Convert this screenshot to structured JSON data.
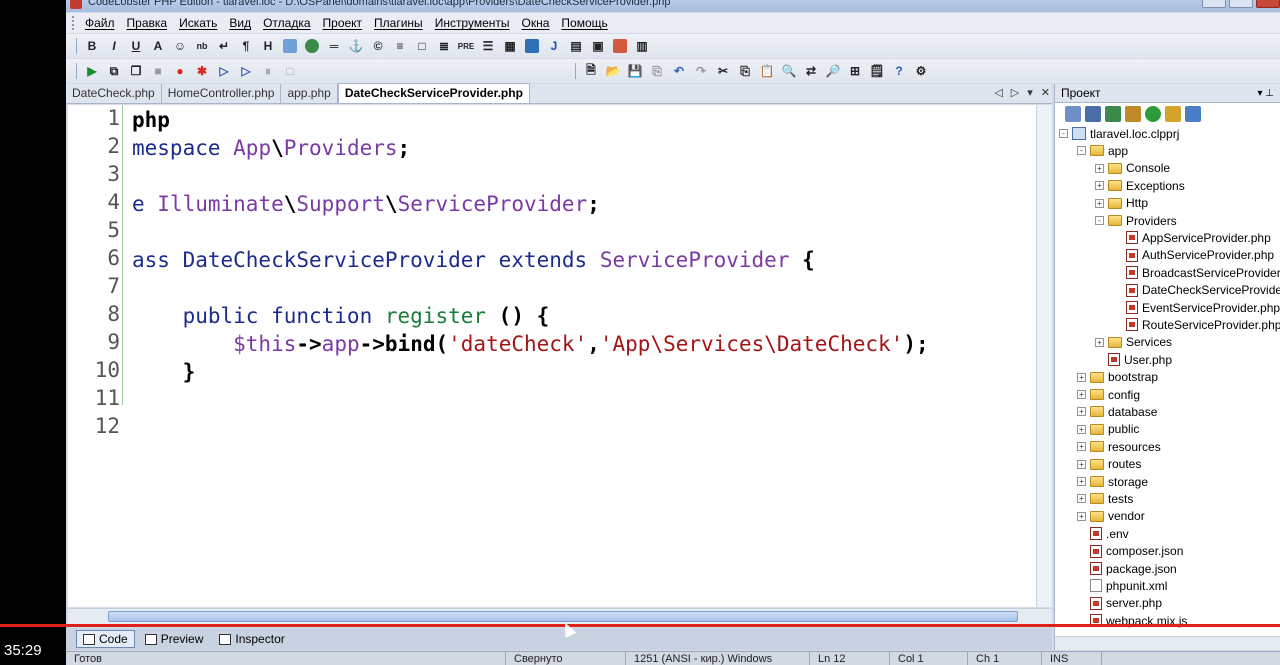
{
  "window": {
    "title": "CodeLobster PHP Edition - tlaravel.loc - D:\\OSPanel\\domains\\tlaravel.loc\\app\\Providers\\DateCheckServiceProvider.php"
  },
  "menu": [
    "Файл",
    "Правка",
    "Искать",
    "Вид",
    "Отладка",
    "Проект",
    "Плагины",
    "Инструменты",
    "Окна",
    "Помощь"
  ],
  "tabs": [
    {
      "label": "DateCheck.php",
      "active": false
    },
    {
      "label": "HomeController.php",
      "active": false
    },
    {
      "label": "app.php",
      "active": false
    },
    {
      "label": "DateCheckServiceProvider.php",
      "active": true
    }
  ],
  "editor": {
    "line_numbers": [
      "1",
      "2",
      "3",
      "4",
      "5",
      "6",
      "7",
      "8",
      "9",
      "10",
      "11",
      "12"
    ],
    "lines": [
      [
        {
          "t": "php",
          "c": "plain"
        }
      ],
      [
        {
          "t": "mespace ",
          "c": "kw"
        },
        {
          "t": "App",
          "c": "cls"
        },
        {
          "t": "\\",
          "c": "plain"
        },
        {
          "t": "Providers",
          "c": "cls"
        },
        {
          "t": ";",
          "c": "plain"
        }
      ],
      [],
      [
        {
          "t": "e ",
          "c": "kw"
        },
        {
          "t": "Illuminate",
          "c": "cls"
        },
        {
          "t": "\\",
          "c": "plain"
        },
        {
          "t": "Support",
          "c": "cls"
        },
        {
          "t": "\\",
          "c": "plain"
        },
        {
          "t": "ServiceProvider",
          "c": "cls"
        },
        {
          "t": ";",
          "c": "plain"
        }
      ],
      [],
      [
        {
          "t": "ass ",
          "c": "kw"
        },
        {
          "t": "DateCheckServiceProvider ",
          "c": "kw"
        },
        {
          "t": "extends ",
          "c": "kw"
        },
        {
          "t": "ServiceProvider ",
          "c": "cls"
        },
        {
          "t": "{",
          "c": "plain"
        }
      ],
      [],
      [
        {
          "t": "    public ",
          "c": "kw"
        },
        {
          "t": "function ",
          "c": "kw"
        },
        {
          "t": "register ",
          "c": "meth"
        },
        {
          "t": "() {",
          "c": "plain"
        }
      ],
      [
        {
          "t": "        $this",
          "c": "var"
        },
        {
          "t": "->",
          "c": "plain"
        },
        {
          "t": "app",
          "c": "var"
        },
        {
          "t": "->",
          "c": "plain"
        },
        {
          "t": "bind",
          "c": "fn"
        },
        {
          "t": "(",
          "c": "plain"
        },
        {
          "t": "'dateCheck'",
          "c": "str"
        },
        {
          "t": ",",
          "c": "plain"
        },
        {
          "t": "'App\\Services\\DateCheck'",
          "c": "str"
        },
        {
          "t": ");",
          "c": "plain"
        }
      ],
      [
        {
          "t": "    }",
          "c": "plain"
        }
      ],
      [],
      []
    ]
  },
  "view_tabs": [
    {
      "label": "Code",
      "active": true
    },
    {
      "label": "Preview",
      "active": false
    },
    {
      "label": "Inspector",
      "active": false
    }
  ],
  "status": [
    "Готов",
    "Свернуто",
    "1251 (ANSI - кир.) Windows",
    "Ln 12",
    "Col 1",
    "Ch 1",
    "INS"
  ],
  "project": {
    "title": "Проект",
    "tree": [
      {
        "label": "tlaravel.loc.clpprj",
        "depth": 0,
        "kind": "project",
        "exp": "-"
      },
      {
        "label": "app",
        "depth": 1,
        "kind": "folder",
        "exp": "-"
      },
      {
        "label": "Console",
        "depth": 2,
        "kind": "folder",
        "exp": "+"
      },
      {
        "label": "Exceptions",
        "depth": 2,
        "kind": "folder",
        "exp": "+"
      },
      {
        "label": "Http",
        "depth": 2,
        "kind": "folder",
        "exp": "+"
      },
      {
        "label": "Providers",
        "depth": 2,
        "kind": "folder",
        "exp": "-"
      },
      {
        "label": "AppServiceProvider.php",
        "depth": 3,
        "kind": "php",
        "exp": ""
      },
      {
        "label": "AuthServiceProvider.php",
        "depth": 3,
        "kind": "php",
        "exp": ""
      },
      {
        "label": "BroadcastServiceProvider.p",
        "depth": 3,
        "kind": "php",
        "exp": ""
      },
      {
        "label": "DateCheckServiceProvider.",
        "depth": 3,
        "kind": "php",
        "exp": ""
      },
      {
        "label": "EventServiceProvider.php",
        "depth": 3,
        "kind": "php",
        "exp": ""
      },
      {
        "label": "RouteServiceProvider.php",
        "depth": 3,
        "kind": "php",
        "exp": ""
      },
      {
        "label": "Services",
        "depth": 2,
        "kind": "folder",
        "exp": "+"
      },
      {
        "label": "User.php",
        "depth": 2,
        "kind": "php",
        "exp": ""
      },
      {
        "label": "bootstrap",
        "depth": 1,
        "kind": "folder",
        "exp": "+"
      },
      {
        "label": "config",
        "depth": 1,
        "kind": "folder",
        "exp": "+"
      },
      {
        "label": "database",
        "depth": 1,
        "kind": "folder",
        "exp": "+"
      },
      {
        "label": "public",
        "depth": 1,
        "kind": "folder",
        "exp": "+"
      },
      {
        "label": "resources",
        "depth": 1,
        "kind": "folder",
        "exp": "+"
      },
      {
        "label": "routes",
        "depth": 1,
        "kind": "folder",
        "exp": "+"
      },
      {
        "label": "storage",
        "depth": 1,
        "kind": "folder",
        "exp": "+"
      },
      {
        "label": "tests",
        "depth": 1,
        "kind": "folder",
        "exp": "+"
      },
      {
        "label": "vendor",
        "depth": 1,
        "kind": "folder",
        "exp": "+"
      },
      {
        "label": ".env",
        "depth": 1,
        "kind": "php",
        "exp": ""
      },
      {
        "label": "composer.json",
        "depth": 1,
        "kind": "php",
        "exp": ""
      },
      {
        "label": "package.json",
        "depth": 1,
        "kind": "php",
        "exp": ""
      },
      {
        "label": "phpunit.xml",
        "depth": 1,
        "kind": "file",
        "exp": ""
      },
      {
        "label": "server.php",
        "depth": 1,
        "kind": "php",
        "exp": ""
      },
      {
        "label": "webpack.mix.js",
        "depth": 1,
        "kind": "php",
        "exp": ""
      }
    ]
  },
  "video": {
    "timecode": "35:29"
  },
  "colors": {
    "progress": "#e0201a",
    "accent": "#1b2c8f"
  }
}
